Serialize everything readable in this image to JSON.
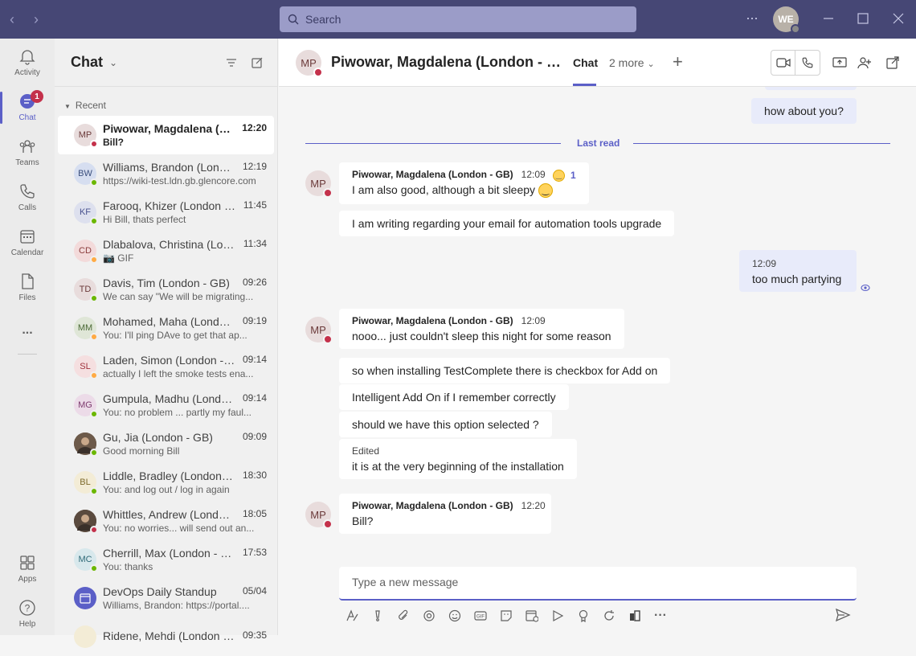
{
  "titlebar": {
    "search_placeholder": "Search",
    "avatar_initials": "WE",
    "more_label": "···"
  },
  "rail": {
    "items": [
      {
        "label": "Activity",
        "icon": "bell-icon"
      },
      {
        "label": "Chat",
        "icon": "chat-icon",
        "badge": "1"
      },
      {
        "label": "Teams",
        "icon": "teams-icon"
      },
      {
        "label": "Calls",
        "icon": "phone-icon"
      },
      {
        "label": "Calendar",
        "icon": "calendar-icon"
      },
      {
        "label": "Files",
        "icon": "file-icon"
      },
      {
        "label": "...",
        "icon": "more-icon"
      },
      {
        "label": "Apps",
        "icon": "apps-icon"
      },
      {
        "label": "Help",
        "icon": "help-icon"
      }
    ]
  },
  "chatlist": {
    "title": "Chat",
    "section": "Recent",
    "chats": [
      {
        "initials": "MP",
        "name": "Piwowar, Magdalena (London - GB)",
        "time": "12:20",
        "preview": "Bill?",
        "status": "busy",
        "bg": "#e8dcdc",
        "fg": "#6b3a3a"
      },
      {
        "initials": "BW",
        "name": "Williams, Brandon (London - GB)",
        "time": "12:19",
        "preview": "https://wiki-test.ldn.gb.glencore.com",
        "status": "available",
        "bg": "#d6def0",
        "fg": "#3b4f7d"
      },
      {
        "initials": "KF",
        "name": "Farooq, Khizer (London - GB)",
        "time": "11:45",
        "preview": "Hi Bill, thats perfect",
        "status": "available",
        "bg": "#dde0ee",
        "fg": "#4a5390"
      },
      {
        "initials": "CD",
        "name": "Dlabalova, Christina (London - GB)",
        "time": "11:34",
        "preview": "📷 GIF",
        "status": "away",
        "bg": "#f3dada",
        "fg": "#8a3b3b"
      },
      {
        "initials": "TD",
        "name": "Davis, Tim (London - GB)",
        "time": "09:26",
        "preview": "We can say \"We will be migrating...",
        "status": "available",
        "bg": "#e8dcdc",
        "fg": "#6b3a3a"
      },
      {
        "initials": "MM",
        "name": "Mohamed, Maha (London - GB)",
        "time": "09:19",
        "preview": "You: I'll ping DAve to get that ap...",
        "status": "away",
        "bg": "#dfe6d7",
        "fg": "#4b6a36"
      },
      {
        "initials": "SL",
        "name": "Laden, Simon (London - GB)",
        "time": "09:14",
        "preview": "actually I left the smoke tests ena...",
        "status": "away",
        "bg": "#f5dfe0",
        "fg": "#a0333d"
      },
      {
        "initials": "MG",
        "name": "Gumpula, Madhu (London - GB)",
        "time": "09:14",
        "preview": "You: no problem ... partly my faul...",
        "status": "available",
        "bg": "#ecdbe8",
        "fg": "#7d3b6f"
      },
      {
        "initials": "",
        "name": "Gu, Jia (London - GB)",
        "time": "09:09",
        "preview": "Good morning Bill",
        "status": "available",
        "bg": "#6d5a4a",
        "fg": "#ffffff",
        "photo": true
      },
      {
        "initials": "BL",
        "name": "Liddle, Bradley (London - GB)",
        "time": "18:30",
        "preview": "You: and log out / log in again",
        "status": "available",
        "bg": "#f3ecd6",
        "fg": "#7d6a2b"
      },
      {
        "initials": "",
        "name": "Whittles, Andrew (London - GB)",
        "time": "18:05",
        "preview": "You: no worries... will send out an...",
        "status": "busy",
        "bg": "#5a4a3e",
        "fg": "#ffffff",
        "photo": true
      },
      {
        "initials": "MC",
        "name": "Cherrill, Max (London - GB)",
        "time": "17:53",
        "preview": "You: thanks",
        "status": "available",
        "bg": "#d8e8ec",
        "fg": "#2f6a78"
      },
      {
        "initials": "",
        "name": "DevOps Daily Standup",
        "time": "05/04",
        "preview": "Williams, Brandon: https://portal....",
        "status": "",
        "bg": "#5b5fc7",
        "fg": "#ffffff",
        "meeting": true
      },
      {
        "initials": "",
        "name": "Ridene, Mehdi (London - GB)",
        "time": "09:35",
        "preview": "",
        "status": "",
        "bg": "#f3ecd6",
        "fg": "#7d6a2b"
      }
    ]
  },
  "header": {
    "initials": "MP",
    "name": "Piwowar, Magdalena (London - GB)",
    "tab": "Chat",
    "more_tabs": "2 more",
    "add": "+"
  },
  "messages": {
    "top_mine": "how about you?",
    "last_read": "Last read",
    "group1": {
      "sender": "Piwowar, Magdalena (London - GB)",
      "time": "12:09",
      "reaction_count": "1",
      "lines": [
        "I am also good, although a bit sleepy",
        "I am writing regarding your email for automation tools upgrade"
      ]
    },
    "mine": {
      "time": "12:09",
      "text": "too much partying"
    },
    "group2": {
      "sender": "Piwowar, Magdalena (London - GB)",
      "time": "12:09",
      "lines": [
        "nooo... just couldn't sleep this night for some reason",
        "so when installing TestComplete there is checkbox for Add on",
        "Intelligent Add On if I remember correctly",
        "should we have this option selected ?"
      ],
      "edited_label": "Edited",
      "edited_text": "it is at the very beginning of the installation"
    },
    "group3": {
      "sender": "Piwowar, Magdalena (London - GB)",
      "time": "12:20",
      "text": "Bill?"
    }
  },
  "compose": {
    "placeholder": "Type a new message"
  },
  "colors": {
    "accent": "#5b5fc7",
    "titlebar": "#464775",
    "busy": "#c4314b",
    "available": "#6bb700",
    "away": "#ffaa44"
  }
}
